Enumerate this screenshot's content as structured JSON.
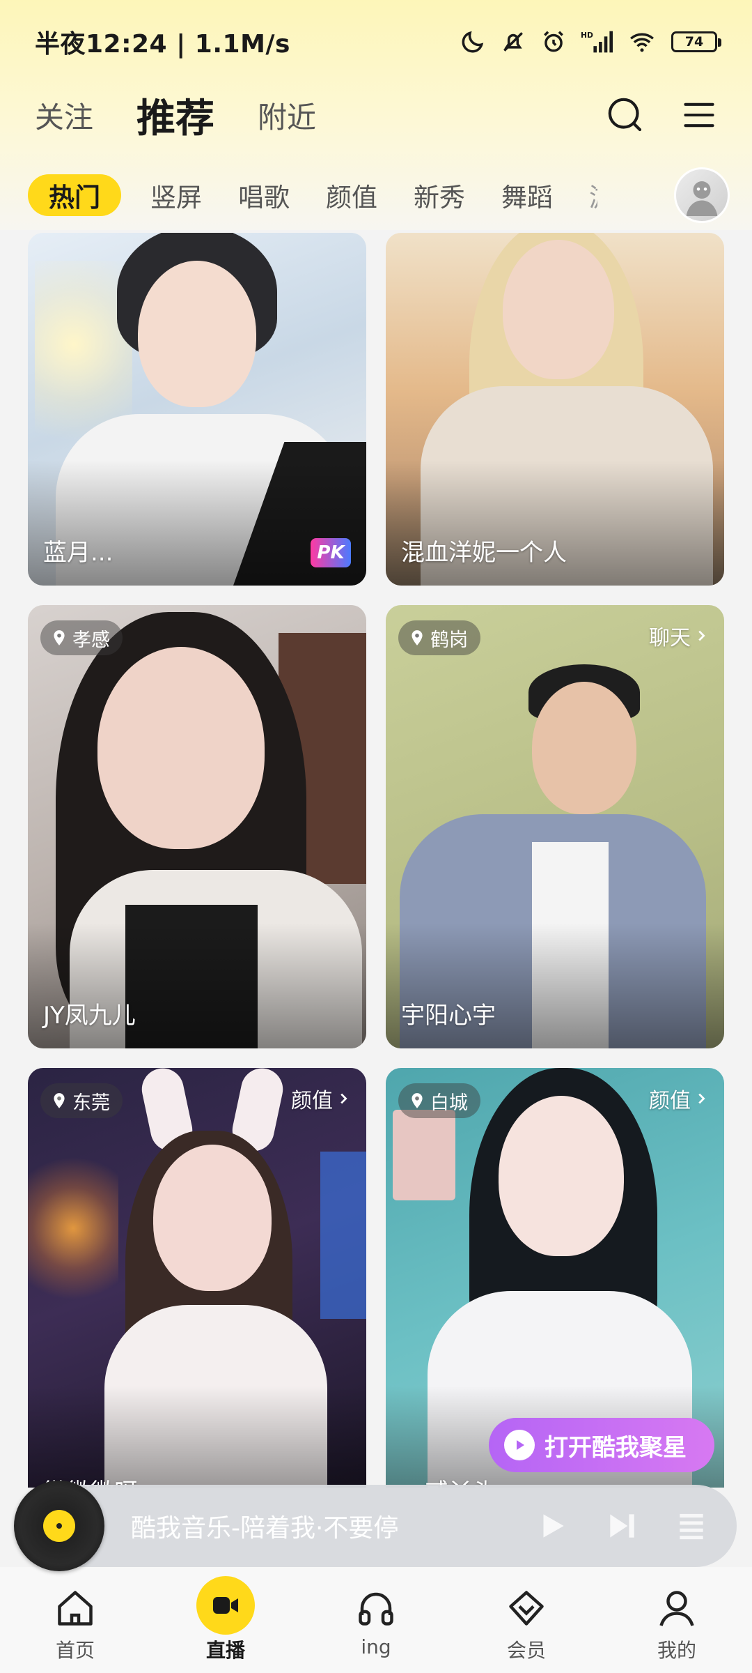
{
  "status_bar": {
    "time_speed": "半夜12:24 | 1.1M/s",
    "battery": "74"
  },
  "top_nav": {
    "tabs": [
      {
        "label": "关注"
      },
      {
        "label": "推荐"
      },
      {
        "label": "附近"
      }
    ],
    "active_tab": "推荐"
  },
  "categories": {
    "items": [
      "热门",
      "竖屏",
      "唱歌",
      "颜值",
      "新秀",
      "舞蹈"
    ],
    "cut_item": "游",
    "active": "热门"
  },
  "cards": [
    {
      "name": "蓝月...",
      "badge": "PK"
    },
    {
      "name": "混血洋妮一个人"
    },
    {
      "name": "JY凤九儿",
      "location": "孝感"
    },
    {
      "name": "宇阳心宇",
      "location": "鹤岗",
      "tag": "聊天"
    },
    {
      "name": "微微微呀",
      "location": "东莞",
      "tag": "颜值"
    },
    {
      "name": "一贰丫头一",
      "location": "白城",
      "tag": "颜值"
    }
  ],
  "promo": {
    "label": "打开酷我聚星"
  },
  "music_bar": {
    "title": "酷我音乐-陪着我·不要停"
  },
  "bottom_nav": {
    "items": [
      {
        "label": "首页"
      },
      {
        "label": "直播"
      },
      {
        "label": "ing"
      },
      {
        "label": "会员"
      },
      {
        "label": "我的"
      }
    ],
    "active": "直播"
  },
  "colors": {
    "accent": "#ffd91a",
    "promo": "#c06cf4",
    "music_bar": "#d7dade"
  }
}
